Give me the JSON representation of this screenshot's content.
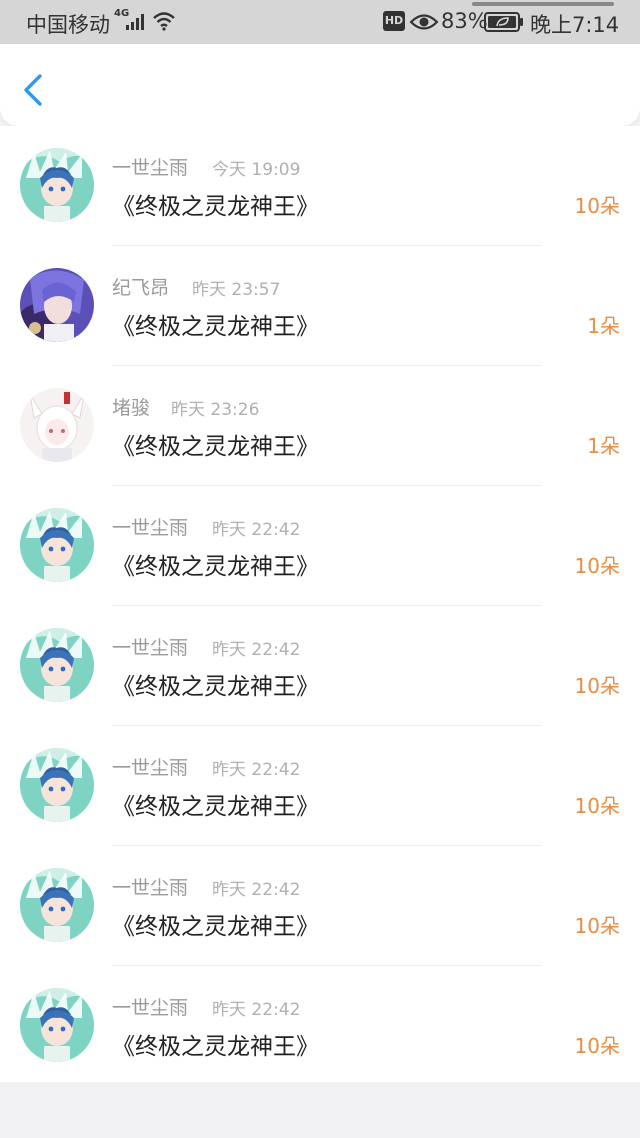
{
  "status_bar": {
    "carrier": "中国移动",
    "signal_tag": "4G",
    "hd_badge": "HD",
    "battery_percent": "83%",
    "time": "晚上7:14"
  },
  "nav": {
    "back_icon": "chevron-left-icon"
  },
  "colors": {
    "accent_blue": "#2b9af3",
    "count_orange": "#f08a3c",
    "name_gray": "#9a9a9a"
  },
  "rows": [
    {
      "name": "一世尘雨",
      "time": "今天 19:09",
      "title": "《终极之灵龙神王》",
      "count": "10朵",
      "avatar": "blue-hair-boy-avatar"
    },
    {
      "name": "纪飞昂",
      "time": "昨天 23:57",
      "title": "《终极之灵龙神王》",
      "count": "1朵",
      "avatar": "purple-hair-avatar"
    },
    {
      "name": "堵骏",
      "time": "昨天 23:26",
      "title": "《终极之灵龙神王》",
      "count": "1朵",
      "avatar": "white-fox-girl-avatar"
    },
    {
      "name": "一世尘雨",
      "time": "昨天 22:42",
      "title": "《终极之灵龙神王》",
      "count": "10朵",
      "avatar": "blue-hair-boy-avatar"
    },
    {
      "name": "一世尘雨",
      "time": "昨天 22:42",
      "title": "《终极之灵龙神王》",
      "count": "10朵",
      "avatar": "blue-hair-boy-avatar"
    },
    {
      "name": "一世尘雨",
      "time": "昨天 22:42",
      "title": "《终极之灵龙神王》",
      "count": "10朵",
      "avatar": "blue-hair-boy-avatar"
    },
    {
      "name": "一世尘雨",
      "time": "昨天 22:42",
      "title": "《终极之灵龙神王》",
      "count": "10朵",
      "avatar": "blue-hair-boy-avatar"
    },
    {
      "name": "一世尘雨",
      "time": "昨天 22:42",
      "title": "《终极之灵龙神王》",
      "count": "10朵",
      "avatar": "blue-hair-boy-avatar"
    }
  ]
}
